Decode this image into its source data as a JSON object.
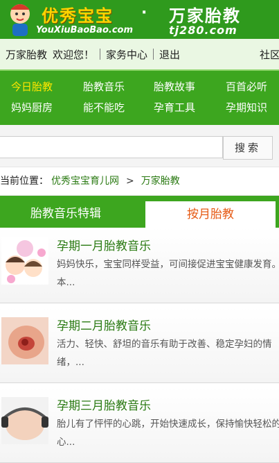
{
  "banner": {
    "brand": "优秀宝宝",
    "dot": "·",
    "brand2": "万家胎教",
    "url1": "YouXiuBaoBao.com",
    "url2": "tj280.com"
  },
  "topnav": {
    "items": [
      "万家胎教",
      "欢迎您！",
      "家务中心",
      "退出",
      "社区"
    ]
  },
  "menu": {
    "items": [
      "今日胎教",
      "胎教音乐",
      "胎教故事",
      "百首必听",
      "妈妈厨房",
      "能不能吃",
      "孕育工具",
      "孕期知识"
    ]
  },
  "search": {
    "placeholder": "",
    "button_label": "搜索"
  },
  "breadcrumb": {
    "prefix": "当前位置：",
    "home": "优秀宝宝育儿网",
    "sep": ">",
    "current": "万家胎教"
  },
  "tabs": {
    "tab1": "胎教音乐特辑",
    "tab2": "按月胎教"
  },
  "list": [
    {
      "title": "孕期一月胎教音乐",
      "desc": "妈妈快乐，宝宝同样受益，可间接促进宝宝健康发育。本..."
    },
    {
      "title": "孕期二月胎教音乐",
      "desc": "活力、轻快、舒坦的音乐有助于改善、稳定孕妇的情绪，..."
    },
    {
      "title": "孕期三月胎教音乐",
      "desc": "胎儿有了怦怦的心跳，开始快速成长，保持愉快轻松的心..."
    }
  ],
  "colors": {
    "brand_green": "#3da61f",
    "accent_orange": "#e65a14",
    "link_green": "#2a7a12",
    "active_yellow": "#ffe600"
  }
}
